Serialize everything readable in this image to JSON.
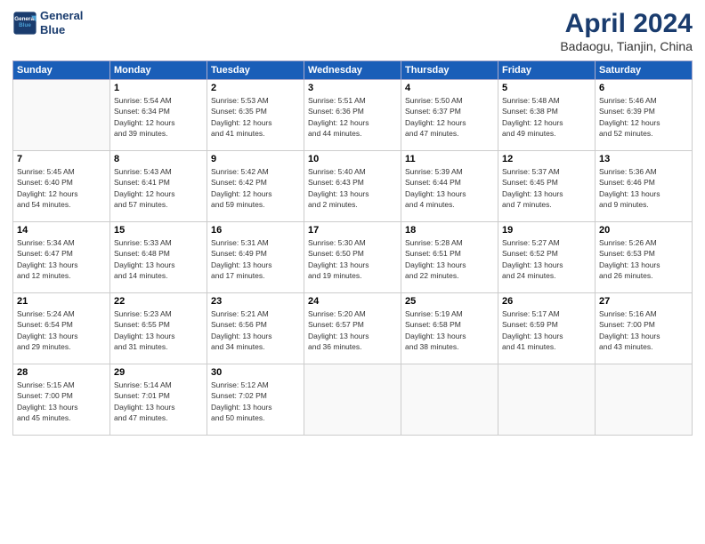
{
  "header": {
    "logo_line1": "General",
    "logo_line2": "Blue",
    "title": "April 2024",
    "subtitle": "Badaogu, Tianjin, China"
  },
  "weekdays": [
    "Sunday",
    "Monday",
    "Tuesday",
    "Wednesday",
    "Thursday",
    "Friday",
    "Saturday"
  ],
  "weeks": [
    [
      {
        "day": "",
        "info": ""
      },
      {
        "day": "1",
        "info": "Sunrise: 5:54 AM\nSunset: 6:34 PM\nDaylight: 12 hours\nand 39 minutes."
      },
      {
        "day": "2",
        "info": "Sunrise: 5:53 AM\nSunset: 6:35 PM\nDaylight: 12 hours\nand 41 minutes."
      },
      {
        "day": "3",
        "info": "Sunrise: 5:51 AM\nSunset: 6:36 PM\nDaylight: 12 hours\nand 44 minutes."
      },
      {
        "day": "4",
        "info": "Sunrise: 5:50 AM\nSunset: 6:37 PM\nDaylight: 12 hours\nand 47 minutes."
      },
      {
        "day": "5",
        "info": "Sunrise: 5:48 AM\nSunset: 6:38 PM\nDaylight: 12 hours\nand 49 minutes."
      },
      {
        "day": "6",
        "info": "Sunrise: 5:46 AM\nSunset: 6:39 PM\nDaylight: 12 hours\nand 52 minutes."
      }
    ],
    [
      {
        "day": "7",
        "info": "Sunrise: 5:45 AM\nSunset: 6:40 PM\nDaylight: 12 hours\nand 54 minutes."
      },
      {
        "day": "8",
        "info": "Sunrise: 5:43 AM\nSunset: 6:41 PM\nDaylight: 12 hours\nand 57 minutes."
      },
      {
        "day": "9",
        "info": "Sunrise: 5:42 AM\nSunset: 6:42 PM\nDaylight: 12 hours\nand 59 minutes."
      },
      {
        "day": "10",
        "info": "Sunrise: 5:40 AM\nSunset: 6:43 PM\nDaylight: 13 hours\nand 2 minutes."
      },
      {
        "day": "11",
        "info": "Sunrise: 5:39 AM\nSunset: 6:44 PM\nDaylight: 13 hours\nand 4 minutes."
      },
      {
        "day": "12",
        "info": "Sunrise: 5:37 AM\nSunset: 6:45 PM\nDaylight: 13 hours\nand 7 minutes."
      },
      {
        "day": "13",
        "info": "Sunrise: 5:36 AM\nSunset: 6:46 PM\nDaylight: 13 hours\nand 9 minutes."
      }
    ],
    [
      {
        "day": "14",
        "info": "Sunrise: 5:34 AM\nSunset: 6:47 PM\nDaylight: 13 hours\nand 12 minutes."
      },
      {
        "day": "15",
        "info": "Sunrise: 5:33 AM\nSunset: 6:48 PM\nDaylight: 13 hours\nand 14 minutes."
      },
      {
        "day": "16",
        "info": "Sunrise: 5:31 AM\nSunset: 6:49 PM\nDaylight: 13 hours\nand 17 minutes."
      },
      {
        "day": "17",
        "info": "Sunrise: 5:30 AM\nSunset: 6:50 PM\nDaylight: 13 hours\nand 19 minutes."
      },
      {
        "day": "18",
        "info": "Sunrise: 5:28 AM\nSunset: 6:51 PM\nDaylight: 13 hours\nand 22 minutes."
      },
      {
        "day": "19",
        "info": "Sunrise: 5:27 AM\nSunset: 6:52 PM\nDaylight: 13 hours\nand 24 minutes."
      },
      {
        "day": "20",
        "info": "Sunrise: 5:26 AM\nSunset: 6:53 PM\nDaylight: 13 hours\nand 26 minutes."
      }
    ],
    [
      {
        "day": "21",
        "info": "Sunrise: 5:24 AM\nSunset: 6:54 PM\nDaylight: 13 hours\nand 29 minutes."
      },
      {
        "day": "22",
        "info": "Sunrise: 5:23 AM\nSunset: 6:55 PM\nDaylight: 13 hours\nand 31 minutes."
      },
      {
        "day": "23",
        "info": "Sunrise: 5:21 AM\nSunset: 6:56 PM\nDaylight: 13 hours\nand 34 minutes."
      },
      {
        "day": "24",
        "info": "Sunrise: 5:20 AM\nSunset: 6:57 PM\nDaylight: 13 hours\nand 36 minutes."
      },
      {
        "day": "25",
        "info": "Sunrise: 5:19 AM\nSunset: 6:58 PM\nDaylight: 13 hours\nand 38 minutes."
      },
      {
        "day": "26",
        "info": "Sunrise: 5:17 AM\nSunset: 6:59 PM\nDaylight: 13 hours\nand 41 minutes."
      },
      {
        "day": "27",
        "info": "Sunrise: 5:16 AM\nSunset: 7:00 PM\nDaylight: 13 hours\nand 43 minutes."
      }
    ],
    [
      {
        "day": "28",
        "info": "Sunrise: 5:15 AM\nSunset: 7:00 PM\nDaylight: 13 hours\nand 45 minutes."
      },
      {
        "day": "29",
        "info": "Sunrise: 5:14 AM\nSunset: 7:01 PM\nDaylight: 13 hours\nand 47 minutes."
      },
      {
        "day": "30",
        "info": "Sunrise: 5:12 AM\nSunset: 7:02 PM\nDaylight: 13 hours\nand 50 minutes."
      },
      {
        "day": "",
        "info": ""
      },
      {
        "day": "",
        "info": ""
      },
      {
        "day": "",
        "info": ""
      },
      {
        "day": "",
        "info": ""
      }
    ]
  ]
}
